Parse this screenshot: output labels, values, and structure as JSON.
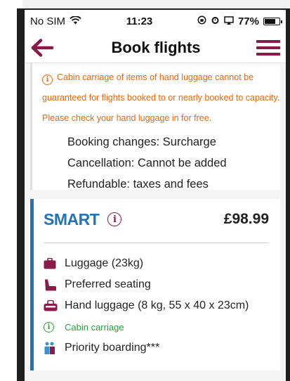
{
  "status_bar": {
    "carrier": "No SIM",
    "time": "11:23",
    "battery": "77%"
  },
  "header": {
    "title": "Book flights"
  },
  "previous_fare": {
    "warning": "Cabin carriage of items of hand luggage cannot be guaranteed for flights booked to or nearly booked to capacity. Please check your hand luggage in for free.",
    "terms": [
      "Booking changes: Surcharge",
      "Cancellation: Cannot be added",
      "Refundable: taxes and fees"
    ]
  },
  "fare": {
    "name": "SMART",
    "price": "£98.99",
    "features": [
      {
        "label": "Luggage (23kg)",
        "icon": "suitcase-icon"
      },
      {
        "label": "Preferred seating",
        "icon": "seat-icon"
      },
      {
        "label": "Hand luggage (8 kg, 55 x 40 x 23cm)",
        "icon": "hand-luggage-icon"
      },
      {
        "label": "Cabin carriage",
        "icon": "info-icon"
      },
      {
        "label": "Priority boarding***",
        "icon": "priority-boarding-icon"
      }
    ]
  },
  "colors": {
    "brand": "#8a1a4a",
    "fare_accent": "#2474b5",
    "warning": "#e8690f",
    "included": "#2e9c3a"
  }
}
